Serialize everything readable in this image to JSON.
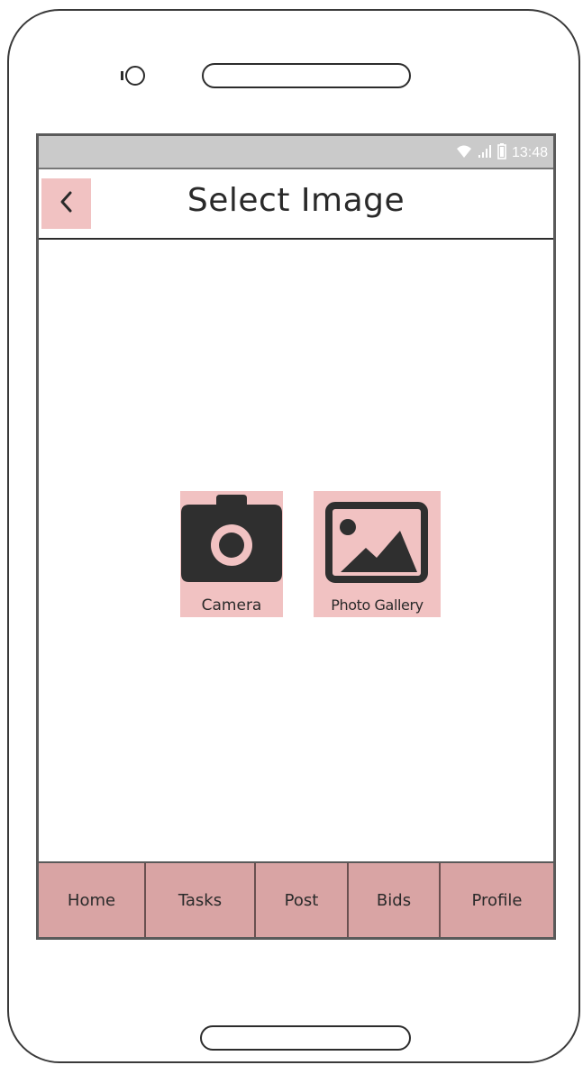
{
  "status_bar": {
    "time": "13:48",
    "icons": [
      "wifi-icon",
      "signal-icon",
      "battery-icon"
    ]
  },
  "header": {
    "title": "Select Image",
    "back_icon": "chevron-left-icon"
  },
  "options": [
    {
      "label": "Camera",
      "icon": "camera-icon"
    },
    {
      "label": "Photo Gallery",
      "icon": "image-gallery-icon"
    }
  ],
  "bottom_nav": {
    "items": [
      {
        "label": "Home"
      },
      {
        "label": "Tasks"
      },
      {
        "label": "Post"
      },
      {
        "label": "Bids"
      },
      {
        "label": "Profile"
      }
    ]
  },
  "colors": {
    "accent_pink": "#f1c2c2",
    "nav_background": "#d9a4a4",
    "status_bar": "#cacaca",
    "icon_dark": "#2f2f2f"
  }
}
